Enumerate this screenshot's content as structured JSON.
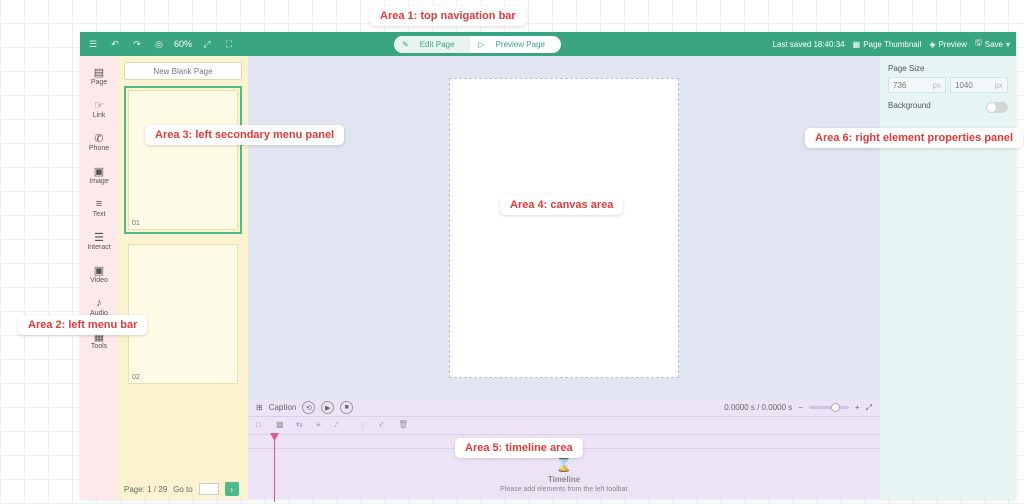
{
  "topbar": {
    "zoom": "60%",
    "edit_page": "Edit Page",
    "preview_page": "Preview Page",
    "last_saved": "Last saved 18:40:34",
    "page_thumbnail": "Page Thumbnail",
    "preview": "Preview",
    "save": "Save"
  },
  "leftbar": {
    "items": [
      {
        "label": "Page"
      },
      {
        "label": "Link"
      },
      {
        "label": "Phone"
      },
      {
        "label": "Image"
      },
      {
        "label": "Text"
      },
      {
        "label": "Interact"
      },
      {
        "label": "Video"
      },
      {
        "label": "Audio"
      },
      {
        "label": "Tools"
      }
    ]
  },
  "secondary": {
    "new_blank_page": "New Blank Page",
    "thumbs": [
      {
        "label": "01"
      },
      {
        "label": "02"
      }
    ],
    "page_current": "Page: 1 / 29",
    "goto_label": "Go to"
  },
  "timeline": {
    "caption": "Caption",
    "timecode": "0.0000 s / 0.0000 s",
    "empty_title": "Timeline",
    "empty_sub": "Please add elements from the left toolbar"
  },
  "rightpanel": {
    "page_size": "Page Size",
    "width": "736",
    "height": "1040",
    "unit": "px",
    "background": "Background"
  },
  "annotations": {
    "a1": "Area 1: top navigation bar",
    "a2": "Area 2: left menu bar",
    "a3": "Area 3: left secondary menu panel",
    "a4": "Area 4: canvas area",
    "a5": "Area 5: timeline area",
    "a6": "Area 6: right element properties panel"
  }
}
